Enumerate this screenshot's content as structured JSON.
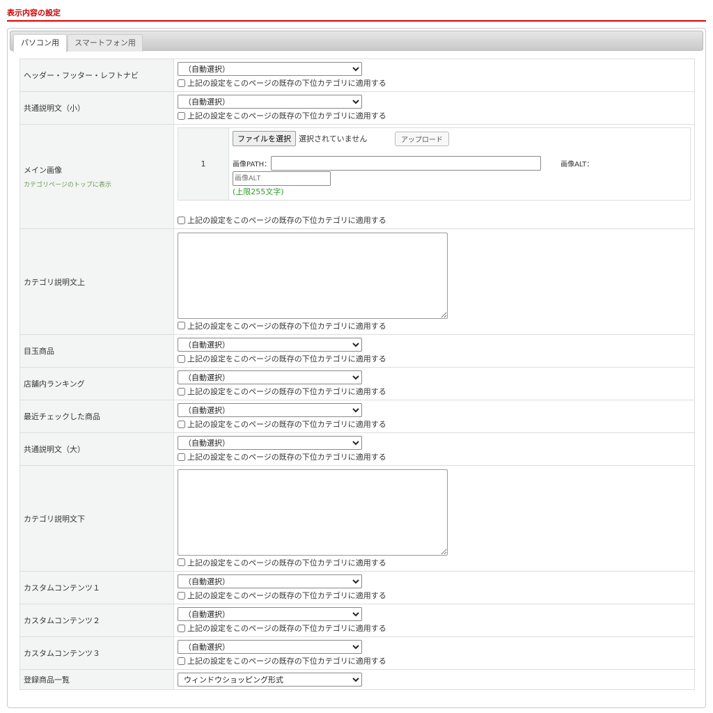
{
  "header": {
    "title": "表示内容の設定"
  },
  "tabs": [
    {
      "label": "パソコン用",
      "active": true
    },
    {
      "label": "スマートフォン用",
      "active": false
    }
  ],
  "apply_label": "上記の設定をこのページの既存の下位カテゴリに適用する",
  "rows": {
    "header_footer": {
      "label": "ヘッダー・フッター・レフトナビ",
      "value": "（自動選択）"
    },
    "common_small": {
      "label": "共通説明文（小）",
      "value": "（自動選択）"
    },
    "main_image": {
      "label": "メイン画像",
      "sublabel": "カテゴリページのトップに表示",
      "index": "1",
      "file_button": "ファイルを選択",
      "file_status": "選択されていません",
      "upload_button": "アップロード",
      "path_label": "画像PATH：",
      "path_value": "",
      "alt_label": "画像ALT：",
      "alt_placeholder": "画像ALT",
      "limit": "(上限255文字)"
    },
    "desc_top": {
      "label": "カテゴリ説明文上",
      "value": ""
    },
    "featured": {
      "label": "目玉商品",
      "value": "（自動選択）"
    },
    "ranking": {
      "label": "店舗内ランキング",
      "value": "（自動選択）"
    },
    "recent": {
      "label": "最近チェックした商品",
      "value": "（自動選択）"
    },
    "common_large": {
      "label": "共通説明文（大）",
      "value": "（自動選択）"
    },
    "desc_bottom": {
      "label": "カテゴリ説明文下",
      "value": ""
    },
    "custom1": {
      "label": "カスタムコンテンツ１",
      "value": "（自動選択）"
    },
    "custom2": {
      "label": "カスタムコンテンツ２",
      "value": "（自動選択）"
    },
    "custom3": {
      "label": "カスタムコンテンツ３",
      "value": "（自動選択）"
    },
    "product_list": {
      "label": "登録商品一覧",
      "value": "ウィンドウショッピング形式"
    }
  }
}
